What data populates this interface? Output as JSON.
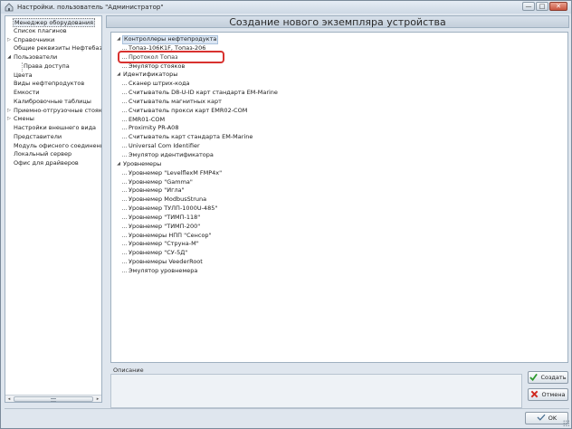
{
  "window": {
    "title": "Настройки. пользователь \"Администратор\""
  },
  "nav": {
    "items": [
      {
        "label": "Менеджер оборудования",
        "level": 0,
        "expander": "",
        "selected": true
      },
      {
        "label": "Список плагинов",
        "level": 0,
        "expander": ""
      },
      {
        "label": "Справочники",
        "level": 0,
        "expander": "▷"
      },
      {
        "label": "Общие реквизиты Нефтебаз",
        "level": 0,
        "expander": ""
      },
      {
        "label": "Пользователи",
        "level": 0,
        "expander": "◢"
      },
      {
        "label": "Права доступа",
        "level": 1,
        "expander": ""
      },
      {
        "label": "Цвета",
        "level": 0,
        "expander": ""
      },
      {
        "label": "Виды нефтепродуктов",
        "level": 0,
        "expander": ""
      },
      {
        "label": "Емкости",
        "level": 0,
        "expander": ""
      },
      {
        "label": "Калибровочные таблицы",
        "level": 0,
        "expander": ""
      },
      {
        "label": "Приемно-отгрузочные стояки",
        "level": 0,
        "expander": "▷"
      },
      {
        "label": "Смены",
        "level": 0,
        "expander": "▷"
      },
      {
        "label": "Настройки внешнего вида",
        "level": 0,
        "expander": ""
      },
      {
        "label": "Представители",
        "level": 0,
        "expander": ""
      },
      {
        "label": "Модуль офисного соединения",
        "level": 0,
        "expander": ""
      },
      {
        "label": "Локальный сервер",
        "level": 0,
        "expander": ""
      },
      {
        "label": "Офис для драйверов",
        "level": 0,
        "expander": ""
      }
    ],
    "scroll_left": "◂",
    "scroll_right": "▸"
  },
  "main": {
    "title": "Создание нового экземпляра устройства",
    "tree": [
      {
        "label": "Контроллеры нефтепродукта",
        "expander": "◢",
        "selected": true,
        "children": [
          {
            "label": "Топаз-106К1F, Топаз-206"
          },
          {
            "label": "Протокол Топаз",
            "highlighted": true
          },
          {
            "label": "Эмулятор стояков"
          }
        ]
      },
      {
        "label": "Идентификаторы",
        "expander": "◢",
        "children": [
          {
            "label": "Сканер штрих-кода"
          },
          {
            "label": "Считыватель D8-U-ID карт стандарта EM-Marine"
          },
          {
            "label": "Считыватель магнитных карт"
          },
          {
            "label": "Считыватель прокси карт EMR02-COM"
          },
          {
            "label": "EMR01-COM"
          },
          {
            "label": "Proximity PR-A08"
          },
          {
            "label": "Считыватель карт стандарта EM-Marine"
          },
          {
            "label": "Universal Com Identifier"
          },
          {
            "label": "Эмулятор идентификатора"
          }
        ]
      },
      {
        "label": "Уровнемеры",
        "expander": "◢",
        "children": [
          {
            "label": "Уровнемер \"LevelflexM FMP4x\""
          },
          {
            "label": "Уровнемер \"Gamma\""
          },
          {
            "label": "Уровнемер \"Игла\""
          },
          {
            "label": "Уровнемер ModbusStruna"
          },
          {
            "label": "Уровнемер ТУЛП-1000U-485\""
          },
          {
            "label": "Уровнемер \"ТИМП-118\""
          },
          {
            "label": "Уровнемер \"ТИМП-200\""
          },
          {
            "label": "Уровнемеры НПП \"Сенсор\""
          },
          {
            "label": "Уровнемер \"Струна-М\""
          },
          {
            "label": "Уровнемер \"СУ-5Д\""
          },
          {
            "label": "Уровнемеры VeederRoot"
          },
          {
            "label": "Эмулятор уровнемера"
          }
        ]
      }
    ],
    "description_label": "Описание",
    "description_value": ""
  },
  "buttons": {
    "create": "Создать",
    "cancel": "Отмена",
    "ok": "OK"
  },
  "colors": {
    "highlight_box": "#d8322f",
    "create_icon": "#2e9a2e",
    "cancel_icon": "#d02a20"
  },
  "icons": {
    "app": "gear-house-icon",
    "create": "checkmark-icon",
    "cancel": "cross-icon",
    "ok": "ok-icon"
  },
  "window_controls": {
    "minimize": "—",
    "maximize": "□",
    "close": "✕"
  }
}
